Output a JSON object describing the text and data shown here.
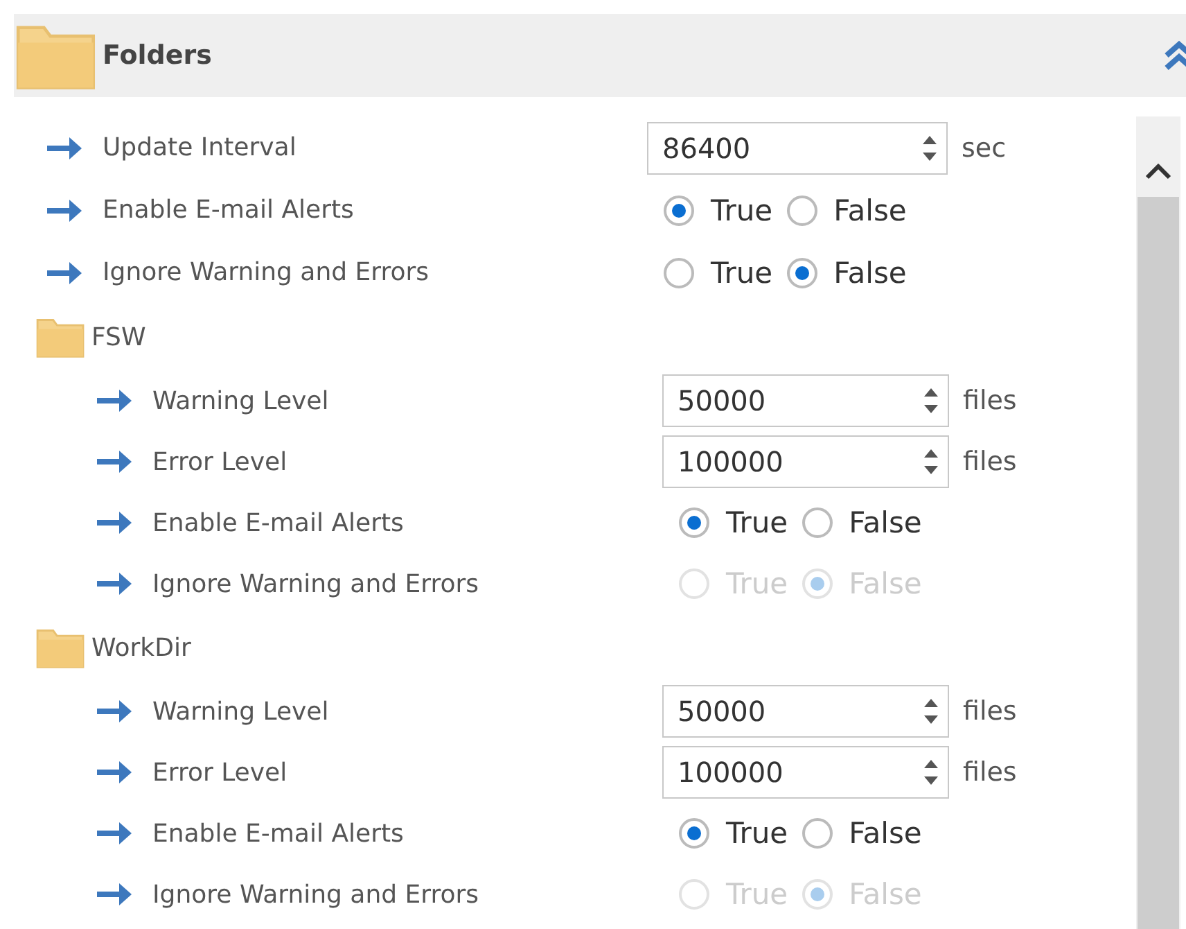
{
  "header": {
    "title": "Folders"
  },
  "settings": [
    {
      "kind": "number",
      "label": "Update Interval",
      "value": "86400",
      "unit": "sec"
    },
    {
      "kind": "boolean",
      "label": "Enable E-mail Alerts",
      "disabled": false,
      "options": [
        {
          "label": "True",
          "selected": true
        },
        {
          "label": "False",
          "selected": false
        }
      ]
    },
    {
      "kind": "boolean",
      "label": "Ignore Warning and Errors",
      "disabled": false,
      "options": [
        {
          "label": "True",
          "selected": false
        },
        {
          "label": "False",
          "selected": true
        }
      ]
    }
  ],
  "folders": [
    {
      "name": "FSW",
      "settings": [
        {
          "kind": "number",
          "label": "Warning Level",
          "value": "50000",
          "unit": "files"
        },
        {
          "kind": "number",
          "label": "Error Level",
          "value": "100000",
          "unit": "files"
        },
        {
          "kind": "boolean",
          "label": "Enable E-mail Alerts",
          "disabled": false,
          "options": [
            {
              "label": "True",
              "selected": true
            },
            {
              "label": "False",
              "selected": false
            }
          ]
        },
        {
          "kind": "boolean",
          "label": "Ignore Warning and Errors",
          "disabled": true,
          "options": [
            {
              "label": "True",
              "selected": false
            },
            {
              "label": "False",
              "selected": true
            }
          ]
        }
      ]
    },
    {
      "name": "WorkDir",
      "settings": [
        {
          "kind": "number",
          "label": "Warning Level",
          "value": "50000",
          "unit": "files"
        },
        {
          "kind": "number",
          "label": "Error Level",
          "value": "100000",
          "unit": "files"
        },
        {
          "kind": "boolean",
          "label": "Enable E-mail Alerts",
          "disabled": false,
          "options": [
            {
              "label": "True",
              "selected": true
            },
            {
              "label": "False",
              "selected": false
            }
          ]
        },
        {
          "kind": "boolean",
          "label": "Ignore Warning and Errors",
          "disabled": true,
          "options": [
            {
              "label": "True",
              "selected": false
            },
            {
              "label": "False",
              "selected": true
            }
          ]
        }
      ]
    }
  ]
}
